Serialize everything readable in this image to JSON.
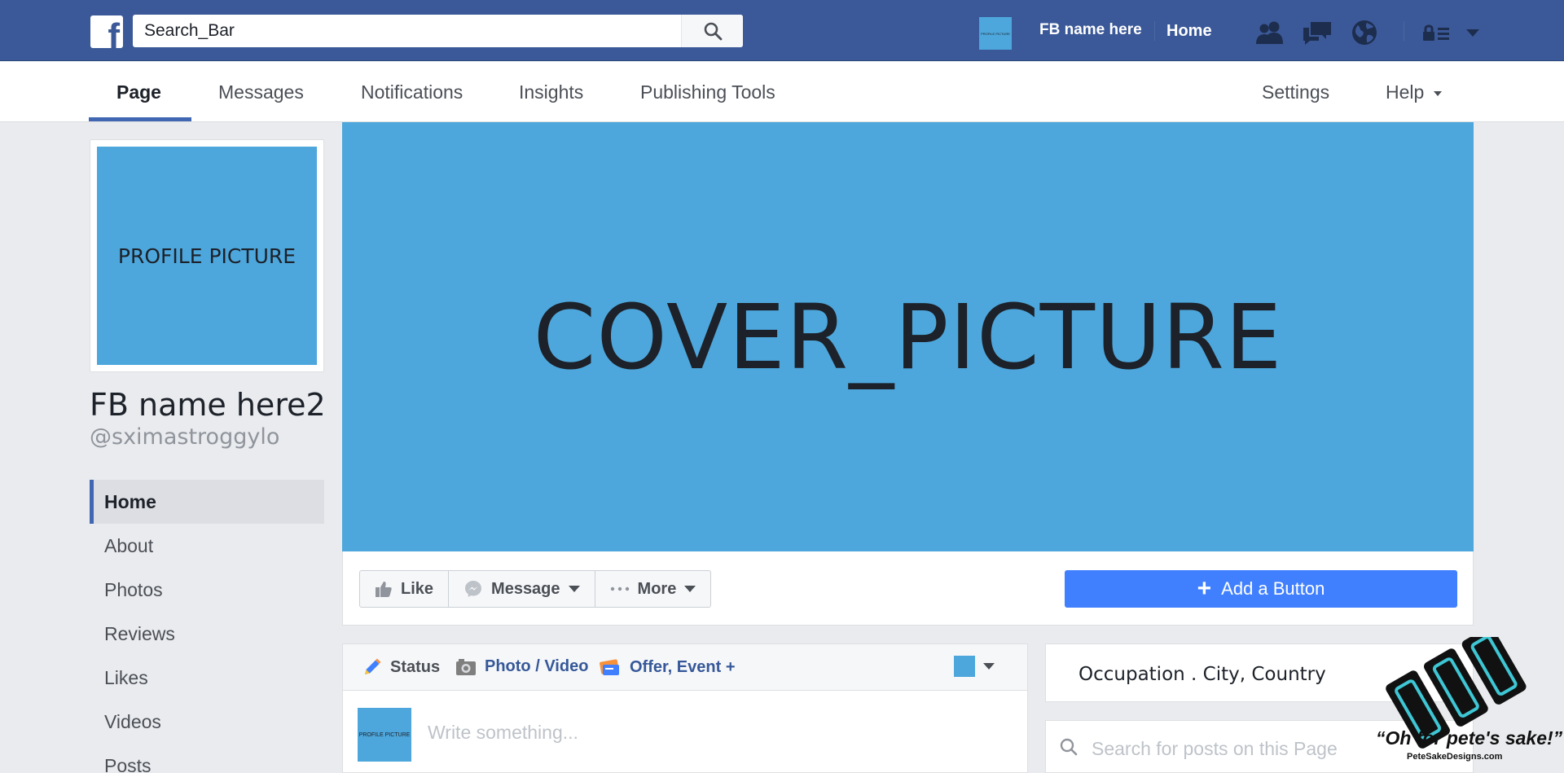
{
  "topbar": {
    "logo_letter": "f",
    "search_value": "Search_Bar",
    "avatar_label": "PROFILE PICTURE",
    "user_name": "FB name here",
    "home_label": "Home",
    "icons": [
      "friends-icon",
      "messages-icon",
      "globe-icon",
      "account-icon",
      "dropdown-icon"
    ]
  },
  "page_nav": {
    "tabs": [
      "Page",
      "Messages",
      "Notifications",
      "Insights",
      "Publishing Tools"
    ],
    "active_tab": "Page",
    "settings_label": "Settings",
    "help_label": "Help"
  },
  "profile": {
    "picture_label": "PROFILE PICTURE",
    "name": "FB name here2",
    "handle": "@sximastroggylo"
  },
  "sidebar": {
    "items": [
      "Home",
      "About",
      "Photos",
      "Reviews",
      "Likes",
      "Videos",
      "Posts"
    ],
    "active": "Home"
  },
  "cover": {
    "label": "COVER_PICTURE"
  },
  "actions": {
    "like_label": "Like",
    "message_label": "Message",
    "more_label": "More",
    "add_button_label": "Add a Button"
  },
  "composer": {
    "status_label": "Status",
    "photo_label": "Photo / Video",
    "offer_label": "Offer, Event +",
    "avatar_label": "PROFILE PICTURE",
    "placeholder": "Write something..."
  },
  "about": {
    "text": "Occupation .  City, Country"
  },
  "page_search": {
    "placeholder": "Search for posts on this Page"
  },
  "watermark": {
    "tagline": "“Oh for pete's sake!”",
    "site": "PeteSakeDesigns.com"
  },
  "colors": {
    "topbar": "#3b5998",
    "picture_blue": "#4da7dc",
    "add_button": "#4080ff",
    "accent": "#4267b2",
    "watermark_teal": "#3ec6d4"
  }
}
